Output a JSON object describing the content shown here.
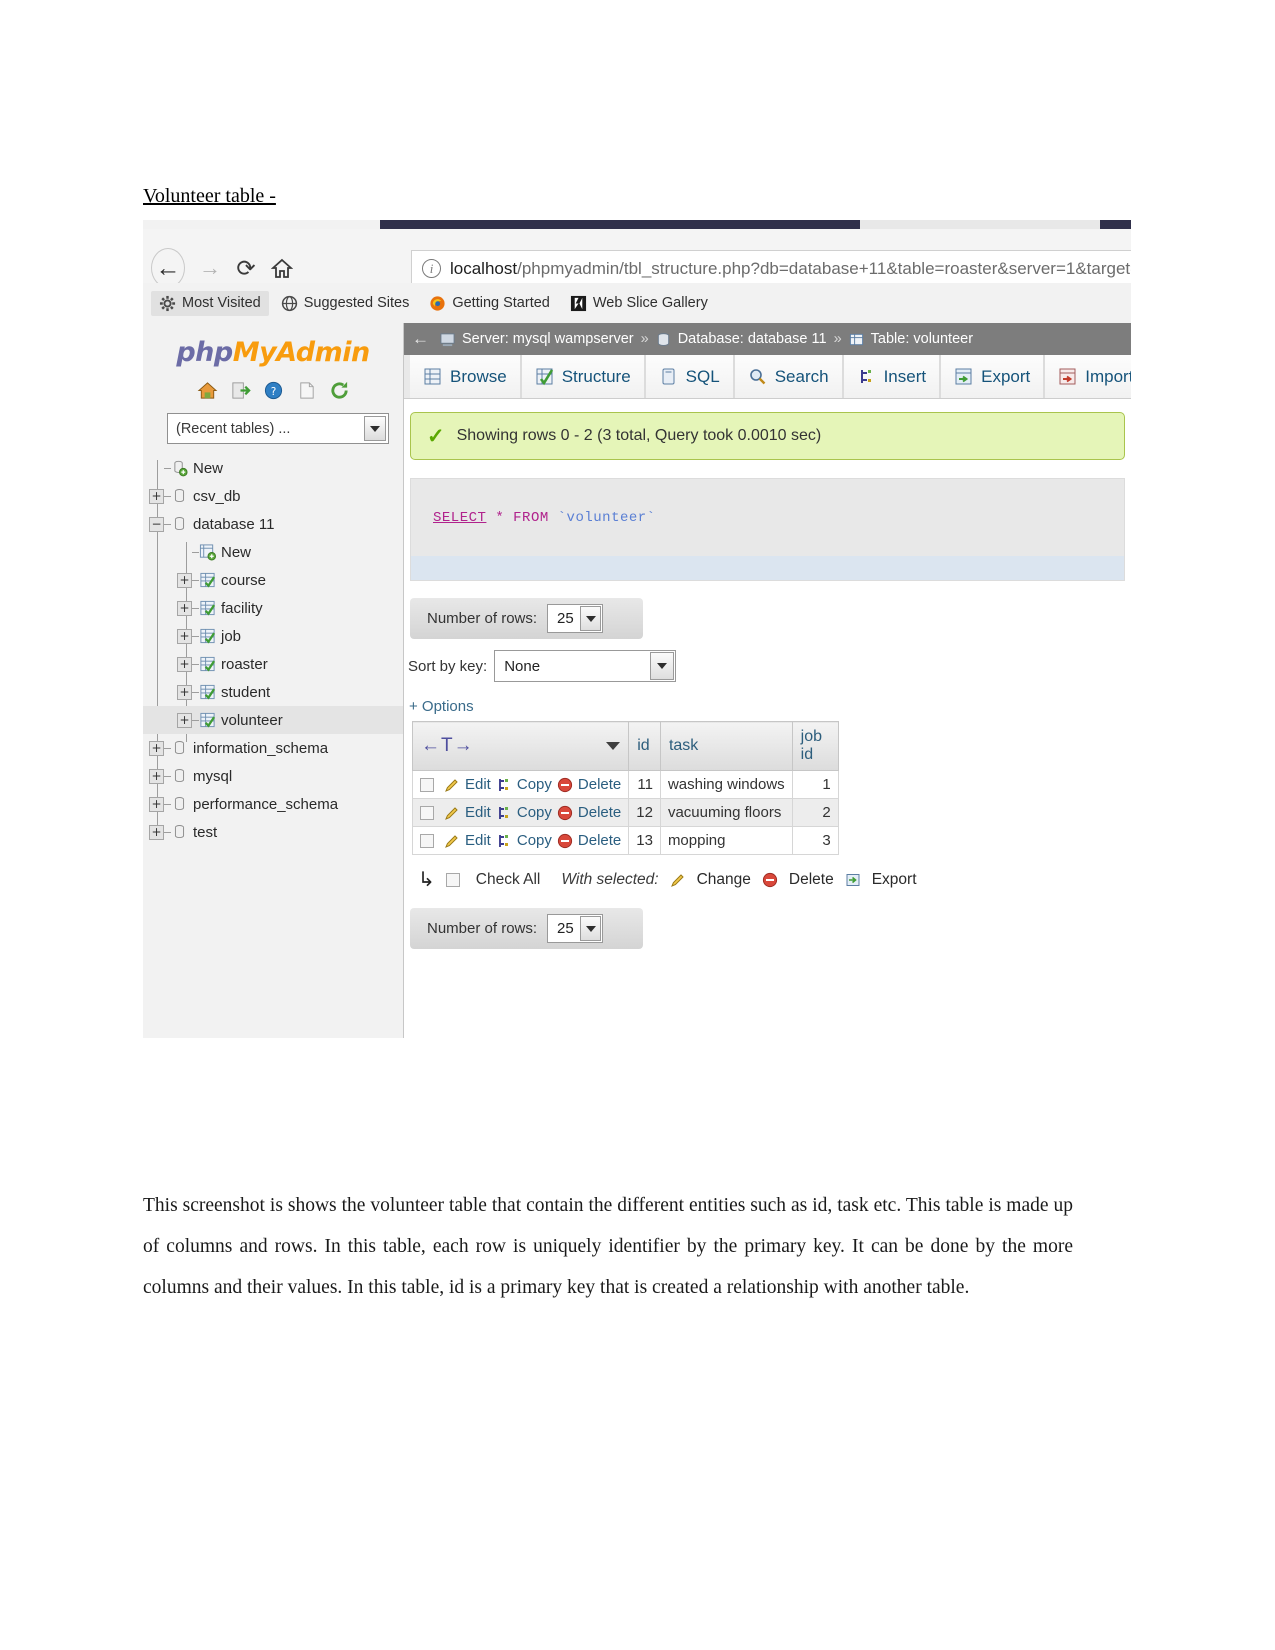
{
  "document": {
    "heading": "Volunteer table -",
    "paragraph": "This screenshot is shows the volunteer table that contain the different entities such as id, task etc. This table is made up of columns and rows. In this table, each row is uniquely identifier by the primary key. It can be done by the more columns and their values. In this table, id is a primary key that is created a relationship with another table."
  },
  "browser": {
    "url_host": "localhost",
    "url_rest": "/phpmyadmin/tbl_structure.php?db=database+11&table=roaster&server=1&target=&token=",
    "bookmarks": [
      {
        "label": "Most Visited",
        "icon": "gear-icon"
      },
      {
        "label": "Suggested Sites",
        "icon": "globe-icon"
      },
      {
        "label": "Getting Started",
        "icon": "firefox-icon"
      },
      {
        "label": "Web Slice Gallery",
        "icon": "webslice-icon"
      }
    ],
    "nav": {
      "back": "back-arrow",
      "forward": "forward-arrow",
      "reload": "reload-icon",
      "home": "home-icon"
    }
  },
  "sidebar": {
    "logo_php": "php",
    "logo_myadmin": "MyAdmin",
    "quick_icons": [
      "home-icon",
      "logout-icon",
      "help-icon",
      "docs-icon",
      "reload-icon"
    ],
    "recent_tables": "(Recent tables) ...",
    "tree": [
      {
        "label": "New",
        "toggle": "",
        "icon": "db-new-icon",
        "depth": 1,
        "selected": false
      },
      {
        "label": "csv_db",
        "toggle": "+",
        "icon": "db-icon",
        "depth": 1,
        "selected": false
      },
      {
        "label": "database 11",
        "toggle": "−",
        "icon": "db-icon",
        "depth": 1,
        "selected": false
      },
      {
        "label": "New",
        "toggle": "",
        "icon": "table-new-icon",
        "depth": 2,
        "selected": false
      },
      {
        "label": "course",
        "toggle": "+",
        "icon": "table-icon",
        "depth": 2,
        "selected": false
      },
      {
        "label": "facility",
        "toggle": "+",
        "icon": "table-icon",
        "depth": 2,
        "selected": false
      },
      {
        "label": "job",
        "toggle": "+",
        "icon": "table-icon",
        "depth": 2,
        "selected": false
      },
      {
        "label": "roaster",
        "toggle": "+",
        "icon": "table-icon",
        "depth": 2,
        "selected": false
      },
      {
        "label": "student",
        "toggle": "+",
        "icon": "table-icon",
        "depth": 2,
        "selected": false
      },
      {
        "label": "volunteer",
        "toggle": "+",
        "icon": "table-icon",
        "depth": 2,
        "selected": true
      },
      {
        "label": "information_schema",
        "toggle": "+",
        "icon": "db-icon",
        "depth": 1,
        "selected": false
      },
      {
        "label": "mysql",
        "toggle": "+",
        "icon": "db-icon",
        "depth": 1,
        "selected": false
      },
      {
        "label": "performance_schema",
        "toggle": "+",
        "icon": "db-icon",
        "depth": 1,
        "selected": false
      },
      {
        "label": "test",
        "toggle": "+",
        "icon": "db-icon",
        "depth": 1,
        "selected": false
      }
    ]
  },
  "breadcrumb": {
    "server_label": "Server: mysql wampserver",
    "sep": "»",
    "database_label": "Database: database 11",
    "table_label": "Table: volunteer"
  },
  "tabs": [
    {
      "label": "Browse",
      "icon": "browse-icon"
    },
    {
      "label": "Structure",
      "icon": "structure-icon"
    },
    {
      "label": "SQL",
      "icon": "sql-icon"
    },
    {
      "label": "Search",
      "icon": "search-icon"
    },
    {
      "label": "Insert",
      "icon": "insert-icon"
    },
    {
      "label": "Export",
      "icon": "export-icon"
    },
    {
      "label": "Import",
      "icon": "import-icon"
    }
  ],
  "result": {
    "status_message": "Showing rows 0 - 2 (3 total, Query took 0.0010 sec)",
    "sql": {
      "select": "SELECT",
      "star": "*",
      "from": "FROM",
      "table": "`volunteer`"
    },
    "rows_label": "Number of rows:",
    "rows_value": "25",
    "sort_label": "Sort by key:",
    "sort_value": "None",
    "options_label": "+ Options",
    "row_actions": {
      "edit": "Edit",
      "copy": "Copy",
      "delete": "Delete"
    },
    "columns": [
      "id",
      "task",
      "job id"
    ],
    "rows": [
      {
        "id": "11",
        "task": "washing windows",
        "job_id": "1"
      },
      {
        "id": "12",
        "task": "vacuuming floors",
        "job_id": "2"
      },
      {
        "id": "13",
        "task": "mopping",
        "job_id": "3"
      }
    ],
    "footer": {
      "check_all": "Check All",
      "with_selected": "With selected:",
      "change": "Change",
      "delete": "Delete",
      "export": "Export"
    },
    "rows_label2": "Number of rows:",
    "rows_value2": "25"
  }
}
